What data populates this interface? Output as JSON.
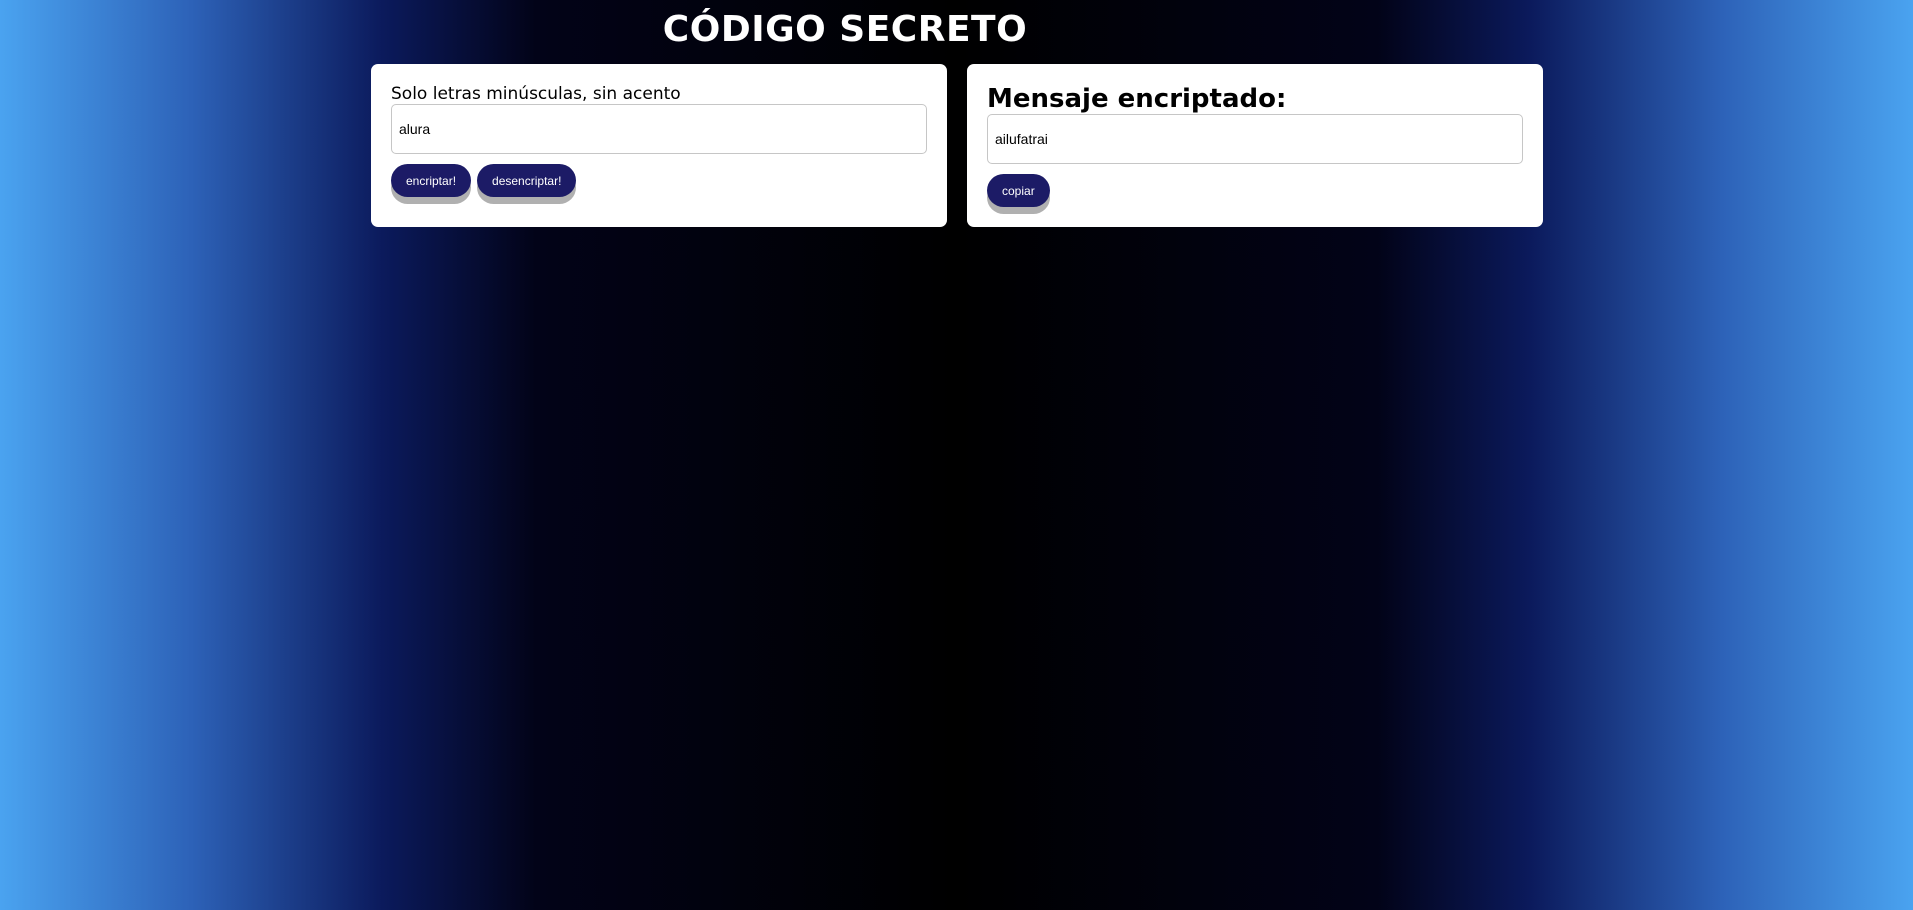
{
  "header": {
    "title": "CÓDIGO SECRETO"
  },
  "input_panel": {
    "label": "Solo letras minúsculas, sin acento",
    "value": "alura",
    "encrypt_label": "encriptar!",
    "decrypt_label": "desencriptar!"
  },
  "output_panel": {
    "heading": "Mensaje encriptado:",
    "value": "ailufatrai",
    "copy_label": "copiar"
  },
  "colors": {
    "button_bg": "#1c1b66",
    "button_text": "#ffffff",
    "button_shadow": "#b0b0b0",
    "card_bg": "#ffffff",
    "page_edge": "#4aa3f0",
    "page_center": "#000000"
  }
}
